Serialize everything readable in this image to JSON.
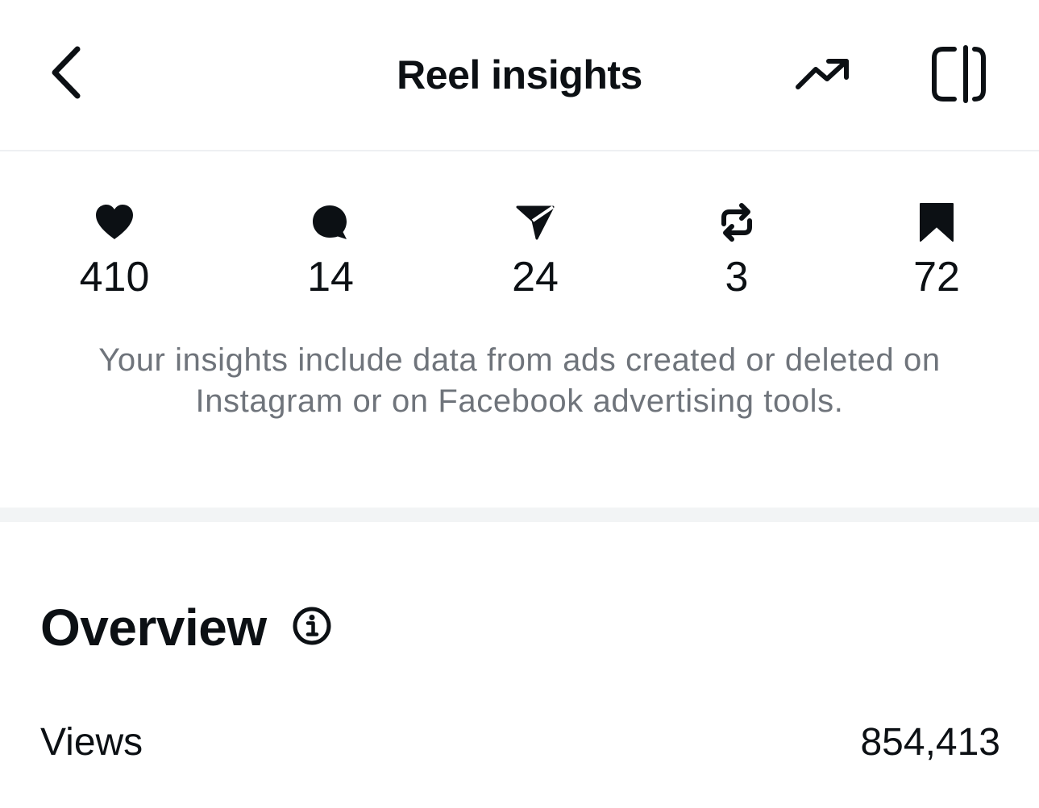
{
  "header": {
    "title": "Reel insights",
    "back_icon": "chevron-left-icon",
    "trend_icon": "trending-up-icon",
    "panel_icon": "side-panel-icon"
  },
  "metrics": [
    {
      "icon": "heart-icon",
      "value": "410"
    },
    {
      "icon": "comment-icon",
      "value": "14"
    },
    {
      "icon": "send-icon",
      "value": "24"
    },
    {
      "icon": "repost-icon",
      "value": "3"
    },
    {
      "icon": "bookmark-icon",
      "value": "72"
    }
  ],
  "notice": "Your insights include data from ads created or deleted on Instagram or on Facebook advertising tools.",
  "overview": {
    "title": "Overview",
    "info_icon": "info-icon",
    "rows": [
      {
        "label": "Views",
        "value": "854,413"
      }
    ]
  },
  "colors": {
    "text": "#0c1014",
    "secondary_text": "#6f747b",
    "divider": "#f2f4f5"
  }
}
